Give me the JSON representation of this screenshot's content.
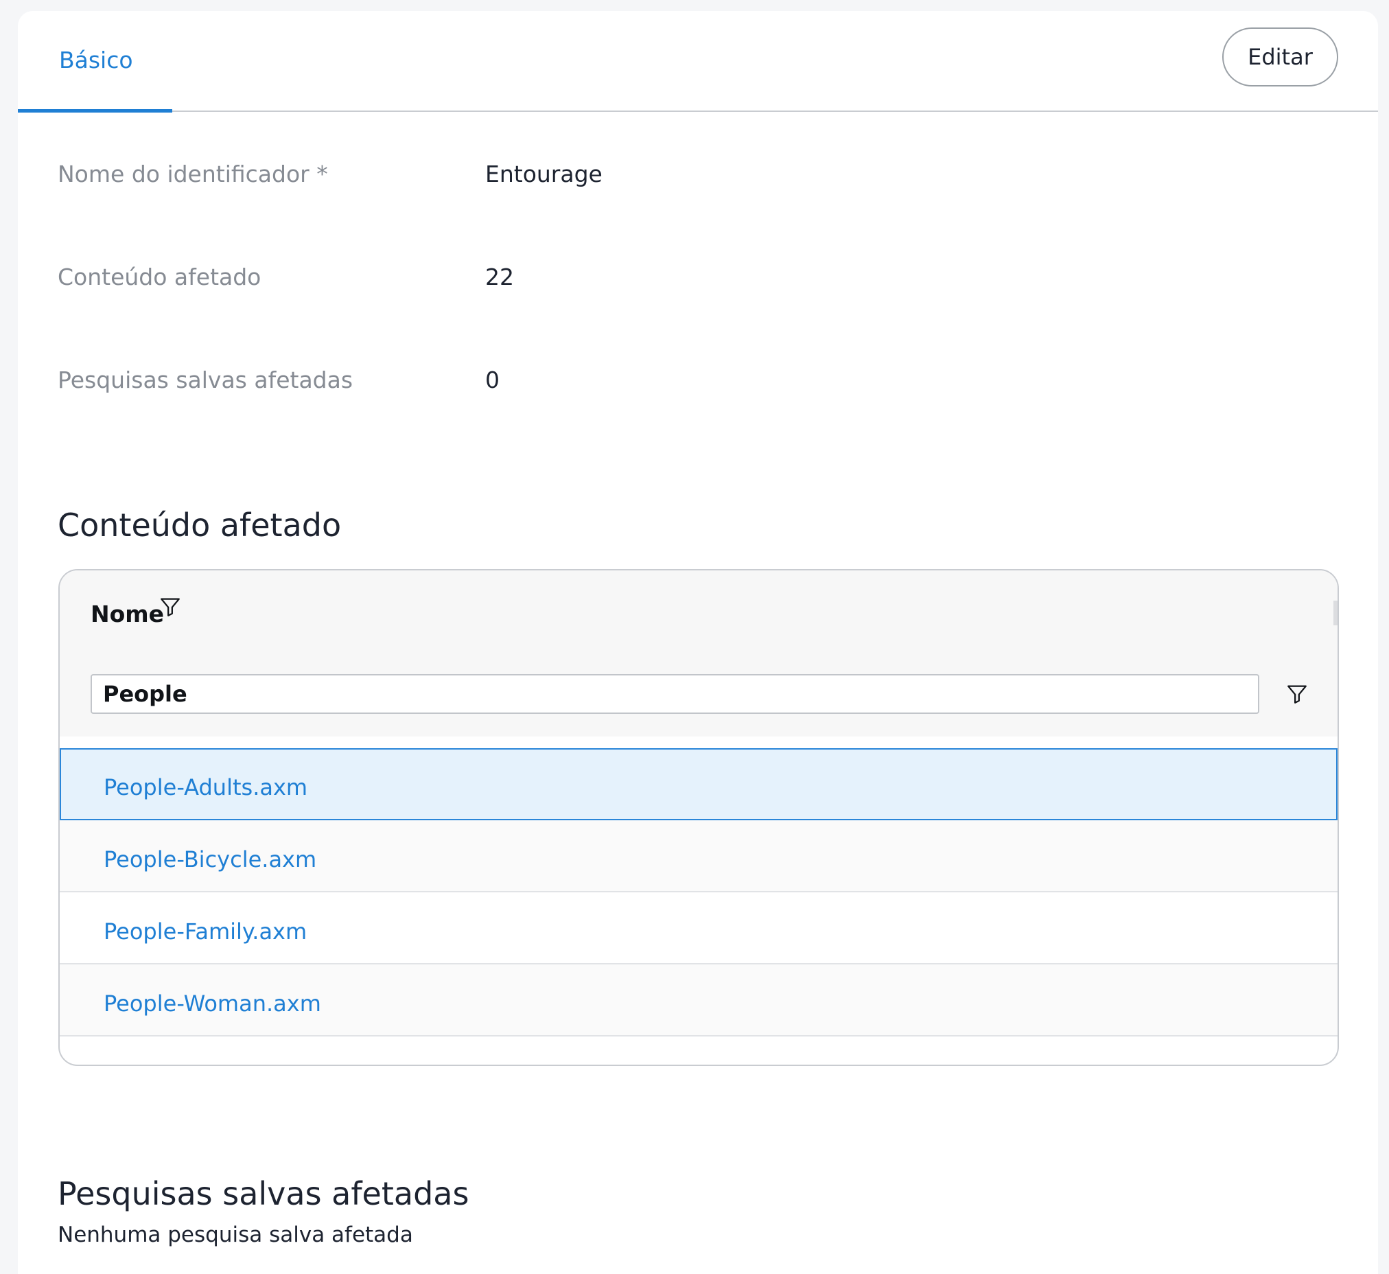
{
  "tabs": [
    {
      "label": "Básico",
      "active": true
    }
  ],
  "header": {
    "edit_label": "Editar"
  },
  "fields": [
    {
      "label": "Nome do identificador *",
      "value": "Entourage"
    },
    {
      "label": "Conteúdo afetado",
      "value": "22"
    },
    {
      "label": "Pesquisas salvas afetadas",
      "value": "0"
    }
  ],
  "affected_content": {
    "title": "Conteúdo afetado",
    "column_header": "Nome",
    "filter_value": "People",
    "rows": [
      {
        "name": "People-Adults.axm",
        "selected": true
      },
      {
        "name": "People-Bicycle.axm",
        "selected": false
      },
      {
        "name": "People-Family.axm",
        "selected": false
      },
      {
        "name": "People-Woman.axm",
        "selected": false
      }
    ]
  },
  "saved_searches": {
    "title": "Pesquisas salvas afetadas",
    "empty_text": "Nenhuma pesquisa salva afetada"
  },
  "colors": {
    "accent": "#1f7fd4",
    "selected_row_bg": "#e5f2fc",
    "label_gray": "#868b93",
    "text_dark": "#1d2330"
  },
  "icons": {
    "column_filter": "filter-funnel-icon",
    "row_filter": "filter-funnel-icon"
  }
}
